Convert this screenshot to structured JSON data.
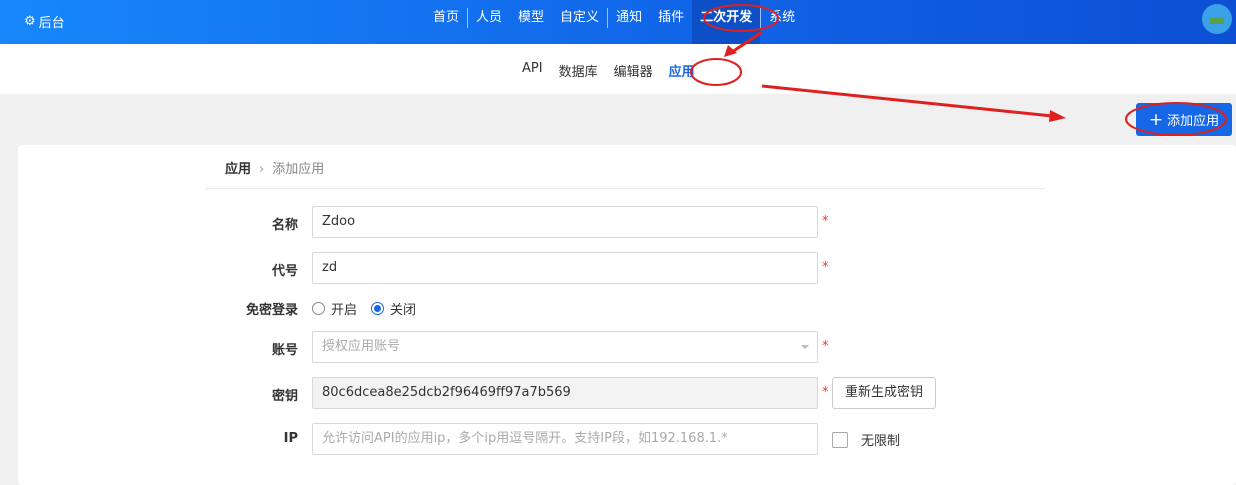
{
  "header": {
    "brand": "后台",
    "nav": [
      {
        "label": "首页"
      },
      {
        "label": "人员"
      },
      {
        "label": "模型"
      },
      {
        "label": "自定义"
      },
      {
        "label": "通知"
      },
      {
        "label": "插件"
      },
      {
        "label": "二次开发",
        "active": true
      },
      {
        "label": "系统"
      }
    ]
  },
  "subnav": [
    {
      "label": "API"
    },
    {
      "label": "数据库"
    },
    {
      "label": "编辑器"
    },
    {
      "label": "应用",
      "active": true
    }
  ],
  "add_button": "添加应用",
  "breadcrumb": {
    "parent": "应用",
    "current": "添加应用"
  },
  "form": {
    "name": {
      "label": "名称",
      "value": "Zdoo"
    },
    "code": {
      "label": "代号",
      "value": "zd"
    },
    "sso": {
      "label": "免密登录",
      "options": [
        "开启",
        "关闭"
      ],
      "selected": "关闭"
    },
    "account": {
      "label": "账号",
      "placeholder": "授权应用账号"
    },
    "secret": {
      "label": "密钥",
      "value": "80c6dcea8e25dcb2f96469ff97a7b569",
      "regen": "重新生成密钥"
    },
    "ip": {
      "label": "IP",
      "placeholder": "允许访问API的应用ip，多个ip用逗号隔开。支持IP段，如192.168.1.*",
      "unlimited": "无限制"
    },
    "required_mark": "*"
  },
  "colors": {
    "accent": "#1667e6",
    "annotation": "#e0201e"
  }
}
